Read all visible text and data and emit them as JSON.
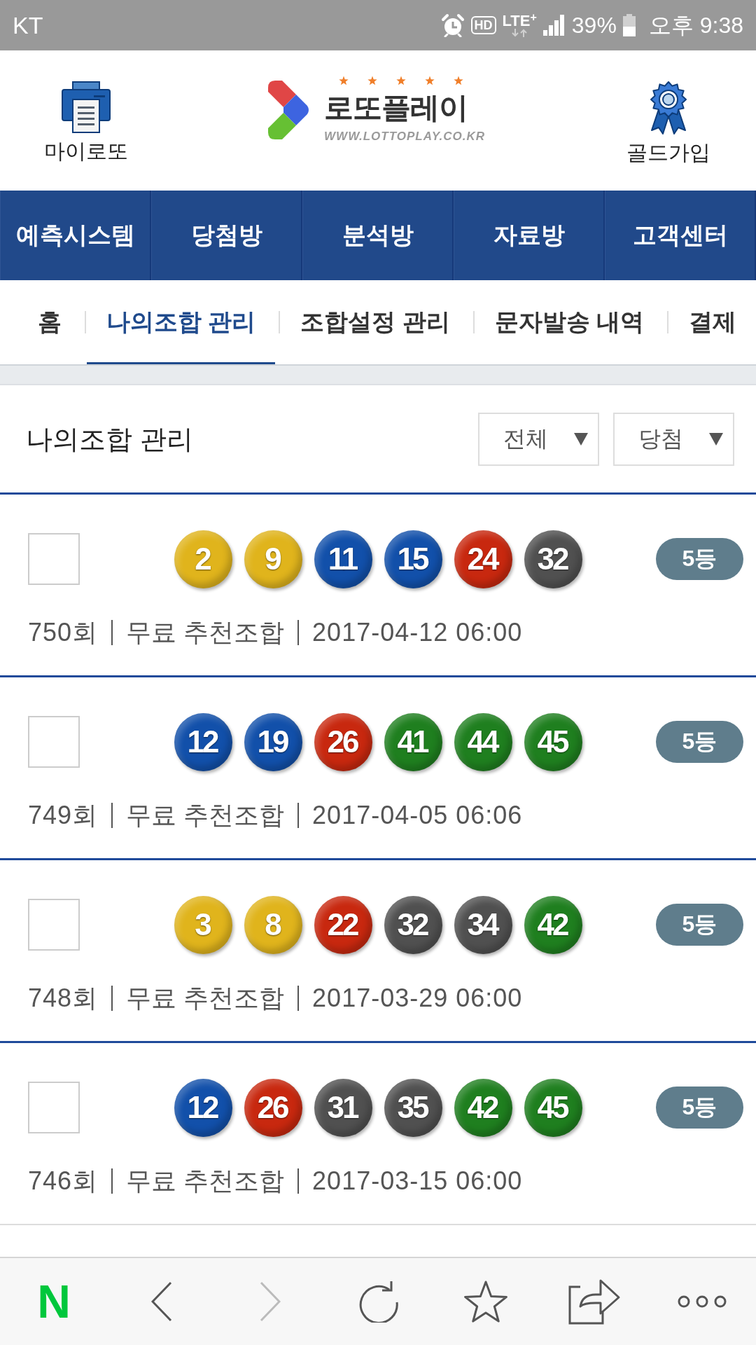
{
  "status_bar": {
    "carrier": "KT",
    "hd": "HD",
    "network": "LTE$^{+}$",
    "battery": "39%",
    "time": "오후 9:38"
  },
  "header": {
    "left": {
      "label": "마이로또"
    },
    "logo": {
      "name": "로또플레이",
      "url": "WWW.LOTTOPLAY.CO.KR"
    },
    "right": {
      "label": "골드가입"
    }
  },
  "main_nav": [
    {
      "label": "예측시스템"
    },
    {
      "label": "당첨방"
    },
    {
      "label": "분석방"
    },
    {
      "label": "자료방"
    },
    {
      "label": "고객센터"
    }
  ],
  "sub_nav": [
    {
      "label": "홈",
      "selected": false
    },
    {
      "label": "나의조합 관리",
      "selected": true
    },
    {
      "label": "조합설정 관리",
      "selected": false
    },
    {
      "label": "문자발송 내역",
      "selected": false
    },
    {
      "label": "결제",
      "selected": false
    }
  ],
  "section": {
    "title": "나의조합 관리",
    "filters": [
      {
        "value": "전체"
      },
      {
        "value": "당첨"
      }
    ]
  },
  "rows": [
    {
      "checked": false,
      "balls": [
        {
          "number": "2",
          "color": "#e0b41c"
        },
        {
          "number": "9",
          "color": "#e0b41c"
        },
        {
          "number": "11",
          "color": "#1250aa"
        },
        {
          "number": "15",
          "color": "#1250aa"
        },
        {
          "number": "24",
          "color": "#c8280f"
        },
        {
          "number": "32",
          "color": "#505050"
        }
      ],
      "rank": "5등",
      "round": "750회",
      "type": "무료 추천조합",
      "date": "2017-04-12 06:00"
    },
    {
      "checked": false,
      "balls": [
        {
          "number": "12",
          "color": "#1250aa"
        },
        {
          "number": "19",
          "color": "#1250aa"
        },
        {
          "number": "26",
          "color": "#c8280f"
        },
        {
          "number": "41",
          "color": "#1f7f1f"
        },
        {
          "number": "44",
          "color": "#1f7f1f"
        },
        {
          "number": "45",
          "color": "#1f7f1f"
        }
      ],
      "rank": "5등",
      "round": "749회",
      "type": "무료 추천조합",
      "date": "2017-04-05 06:06"
    },
    {
      "checked": false,
      "balls": [
        {
          "number": "3",
          "color": "#e0b41c"
        },
        {
          "number": "8",
          "color": "#e0b41c"
        },
        {
          "number": "22",
          "color": "#c8280f"
        },
        {
          "number": "32",
          "color": "#505050"
        },
        {
          "number": "34",
          "color": "#505050"
        },
        {
          "number": "42",
          "color": "#1f7f1f"
        }
      ],
      "rank": "5등",
      "round": "748회",
      "type": "무료 추천조합",
      "date": "2017-03-29 06:00"
    },
    {
      "checked": false,
      "balls": [
        {
          "number": "12",
          "color": "#1250aa"
        },
        {
          "number": "26",
          "color": "#c8280f"
        },
        {
          "number": "31",
          "color": "#505050"
        },
        {
          "number": "35",
          "color": "#505050"
        },
        {
          "number": "42",
          "color": "#1f7f1f"
        },
        {
          "number": "45",
          "color": "#1f7f1f"
        }
      ],
      "rank": "5등",
      "round": "746회",
      "type": "무료 추천조합",
      "date": "2017-03-15 06:00"
    }
  ],
  "browser_bar": {
    "logo": "N",
    "buttons": [
      {
        "kind": "back",
        "disabled": false
      },
      {
        "kind": "forward",
        "disabled": true
      },
      {
        "kind": "reload",
        "disabled": false
      },
      {
        "kind": "bookmark",
        "disabled": false
      },
      {
        "kind": "share",
        "disabled": false
      },
      {
        "kind": "more",
        "disabled": false
      }
    ]
  }
}
